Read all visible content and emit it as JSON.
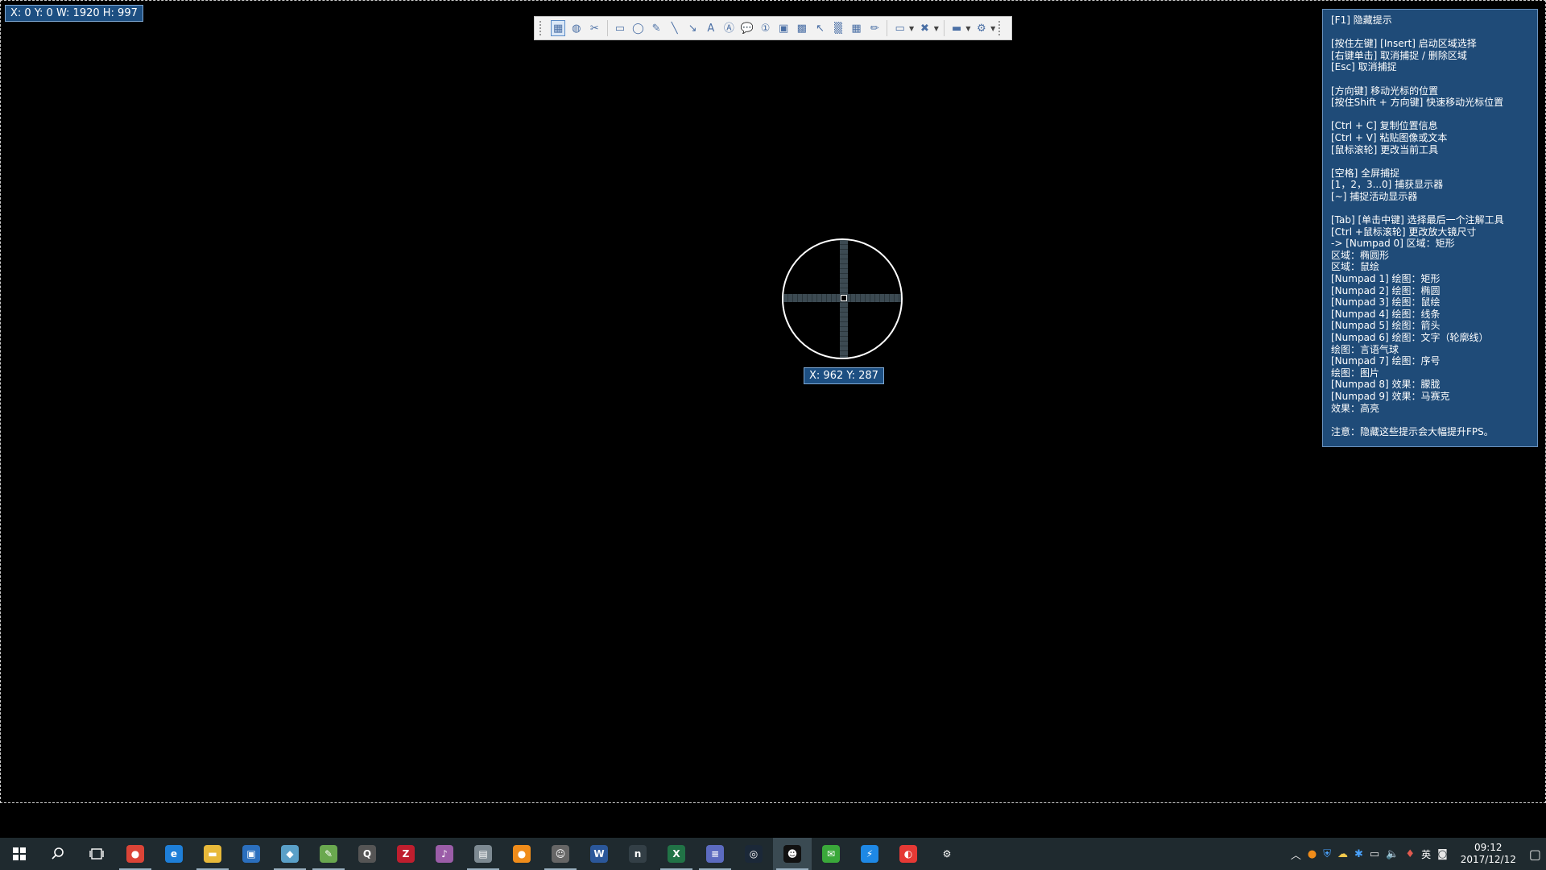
{
  "selection": {
    "readout": "X: 0 Y: 0 W: 1920 H: 997"
  },
  "cursor": {
    "readout": "X: 962 Y: 287"
  },
  "toolbar": {
    "icons": [
      "region-rect-icon",
      "region-ellipse-icon",
      "region-freehand-icon",
      "draw-rect-icon",
      "draw-ellipse-icon",
      "draw-freehand-icon",
      "draw-line-icon",
      "draw-arrow-icon",
      "text-icon",
      "text-outline-icon",
      "speech-balloon-icon",
      "step-number-icon",
      "image-icon",
      "image-alt-icon",
      "cursor-icon",
      "blur-icon",
      "pixelate-icon",
      "highlight-icon",
      "capture-options-icon",
      "tools-icon",
      "screen-icon",
      "settings-icon"
    ]
  },
  "hints": {
    "lines": [
      "[F1] 隐藏提示",
      "",
      "[按住左键] [Insert] 启动区域选择",
      "[右键单击] 取消捕捉 / 删除区域",
      "[Esc] 取消捕捉",
      "",
      "[方向键] 移动光标的位置",
      "[按住Shift + 方向键] 快速移动光标位置",
      "",
      "[Ctrl + C] 复制位置信息",
      "[Ctrl + V] 粘贴图像或文本",
      "[鼠标滚轮] 更改当前工具",
      "",
      "[空格] 全屏捕捉",
      "[1，2，3...0] 捕获显示器",
      "[~] 捕捉活动显示器",
      "",
      "[Tab] [单击中键] 选择最后一个注解工具",
      "[Ctrl +鼠标滚轮] 更改放大镜尺寸",
      "-> [Numpad 0] 区域：矩形",
      "区域：椭圆形",
      "区域：鼠绘",
      "[Numpad 1] 绘图：矩形",
      "[Numpad 2] 绘图：椭圆",
      "[Numpad 3] 绘图：鼠绘",
      "[Numpad 4] 绘图：线条",
      "[Numpad 5] 绘图：箭头",
      "[Numpad 6] 绘图：文字（轮廓线）",
      "绘图：言语气球",
      "[Numpad 7] 绘图：序号",
      "绘图：图片",
      "[Numpad 8] 效果：朦胧",
      "[Numpad 9] 效果：马赛克",
      "效果：高亮",
      "",
      "注意：隐藏这些提示会大幅提升FPS。"
    ]
  },
  "taskbar": {
    "apps": [
      {
        "name": "chrome",
        "glyph": "●",
        "color": "#db4437",
        "running": true
      },
      {
        "name": "edge",
        "glyph": "e",
        "color": "#1e7fd8",
        "running": false
      },
      {
        "name": "file-explorer",
        "glyph": "▬",
        "color": "#e8b93a",
        "running": true
      },
      {
        "name": "store",
        "glyph": "▣",
        "color": "#2b6fbe",
        "running": false
      },
      {
        "name": "notebook",
        "glyph": "◆",
        "color": "#5aa0c8",
        "running": true
      },
      {
        "name": "notepad",
        "glyph": "✎",
        "color": "#6aa84f",
        "running": true
      },
      {
        "name": "app-q",
        "glyph": "Q",
        "color": "#555555",
        "running": false
      },
      {
        "name": "filezilla",
        "glyph": "Z",
        "color": "#bf1e2e",
        "running": false
      },
      {
        "name": "music",
        "glyph": "♪",
        "color": "#9b5da8",
        "running": false
      },
      {
        "name": "calendar",
        "glyph": "▤",
        "color": "#7d8a92",
        "running": true
      },
      {
        "name": "orange-app",
        "glyph": "●",
        "color": "#f08c1a",
        "running": false
      },
      {
        "name": "face-app",
        "glyph": "☺",
        "color": "#666666",
        "running": true
      },
      {
        "name": "word",
        "glyph": "W",
        "color": "#2b579a",
        "running": false
      },
      {
        "name": "nox",
        "glyph": "n",
        "color": "#333f46",
        "running": false
      },
      {
        "name": "excel",
        "glyph": "X",
        "color": "#217346",
        "running": true
      },
      {
        "name": "media",
        "glyph": "≡",
        "color": "#5c6bc0",
        "running": true
      },
      {
        "name": "steam",
        "glyph": "◎",
        "color": "#1b2838",
        "running": false
      },
      {
        "name": "qq",
        "glyph": "☻",
        "color": "#111111",
        "running": true,
        "highlight": true
      },
      {
        "name": "wechat",
        "glyph": "✉",
        "color": "#3aa83a",
        "running": false
      },
      {
        "name": "thunder",
        "glyph": "⚡",
        "color": "#1e88e5",
        "running": false
      },
      {
        "name": "browser",
        "glyph": "◐",
        "color": "#e53935",
        "running": false
      },
      {
        "name": "settings",
        "glyph": "⚙",
        "color": "transparent",
        "running": false
      }
    ],
    "tray": {
      "ime": "英",
      "time": "09:12",
      "date": "2017/12/12"
    }
  }
}
